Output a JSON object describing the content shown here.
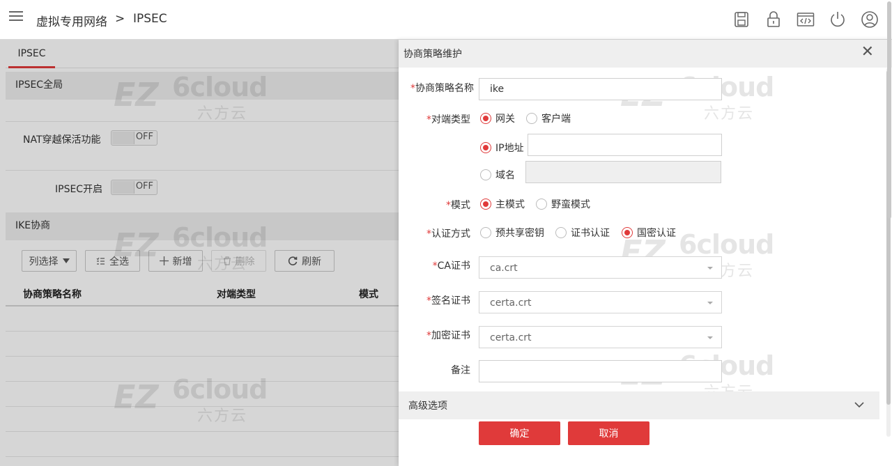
{
  "header": {
    "breadcrumb_parent": "虚拟专用网络",
    "breadcrumb_sep": ">",
    "breadcrumb_current": "IPSEC",
    "icons": [
      "save-icon",
      "lock-icon",
      "code-window-icon",
      "power-icon",
      "user-icon"
    ]
  },
  "left": {
    "tab": "IPSEC",
    "global_section": "IPSEC全局",
    "nat_label": "NAT穿越保活功能",
    "nat_state": "OFF",
    "ipsec_label": "IPSEC开启",
    "ipsec_state": "OFF",
    "ike_section": "IKE协商",
    "toolbar": {
      "columns": "列选择",
      "select_all": "全选",
      "add": "新增",
      "delete": "删除",
      "refresh": "刷新"
    },
    "table_headers": [
      "协商策略名称",
      "对端类型",
      "模式"
    ]
  },
  "watermark": {
    "mark": "6cloud",
    "cn": "六方云"
  },
  "dialog": {
    "title": "协商策略维护",
    "close": "✕",
    "req_mark": "*",
    "name_label": "协商策略名称",
    "name_value": "ike",
    "peer_label": "对端类型",
    "peer_gateway": "网关",
    "peer_client": "客户端",
    "ip_option": "IP地址",
    "ip_value": "",
    "domain_option": "域名",
    "domain_value": "",
    "mode_label": "模式",
    "mode_main": "主模式",
    "mode_aggressive": "野蛮模式",
    "auth_label": "认证方式",
    "auth_psk": "预共享密钥",
    "auth_cert": "证书认证",
    "auth_sm": "国密认证",
    "ca_label": "CA证书",
    "ca_value": "ca.crt",
    "sign_label": "签名证书",
    "sign_value": "certa.crt",
    "enc_label": "加密证书",
    "enc_value": "certa.crt",
    "note_label": "备注",
    "note_value": "",
    "advanced": "高级选项",
    "ok": "确定",
    "cancel": "取消"
  },
  "colors": {
    "accent": "#e03a3a",
    "section_bg": "#efefef"
  }
}
